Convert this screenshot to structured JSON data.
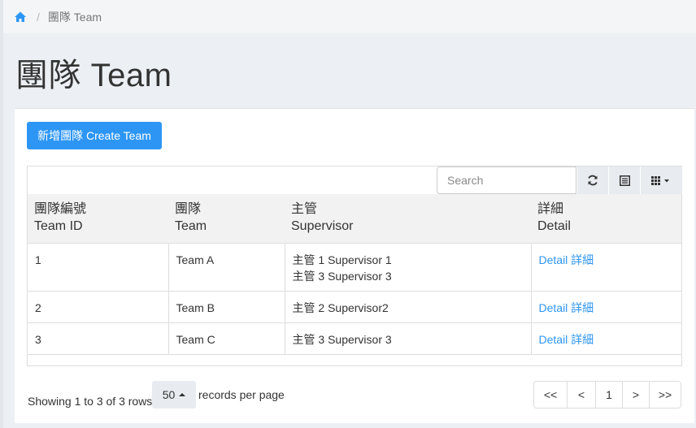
{
  "breadcrumb": {
    "home_icon": "home-icon",
    "separator": "/",
    "current": "團隊 Team"
  },
  "page": {
    "title": "團隊 Team"
  },
  "actions": {
    "create_label": "新增團隊 Create Team",
    "accent": "#2d96f5"
  },
  "toolbar": {
    "search_placeholder": "Search",
    "refresh_icon": "refresh-icon",
    "list_icon": "list-view-icon",
    "columns_icon": "columns-grid-icon"
  },
  "table": {
    "headers": [
      {
        "zh": "團隊編號",
        "en": "Team ID"
      },
      {
        "zh": "團隊",
        "en": "Team"
      },
      {
        "zh": "主管",
        "en": "Supervisor"
      },
      {
        "zh": "詳細",
        "en": "Detail"
      }
    ],
    "rows": [
      {
        "id": "1",
        "team": "Team A",
        "supervisors": [
          "主管 1 Supervisor 1",
          "主管 3 Supervisor 3"
        ],
        "detail": "Detail 詳細"
      },
      {
        "id": "2",
        "team": "Team B",
        "supervisors": [
          "主管 2 Supervisor2"
        ],
        "detail": "Detail 詳細"
      },
      {
        "id": "3",
        "team": "Team C",
        "supervisors": [
          "主管 3 Supervisor 3"
        ],
        "detail": "Detail 詳細"
      }
    ]
  },
  "footer": {
    "showing": "Showing 1 to 3 of 3 rows",
    "page_size": "50",
    "records_label": "records per page",
    "pager": [
      "<<",
      "<",
      "1",
      ">",
      ">>"
    ]
  }
}
